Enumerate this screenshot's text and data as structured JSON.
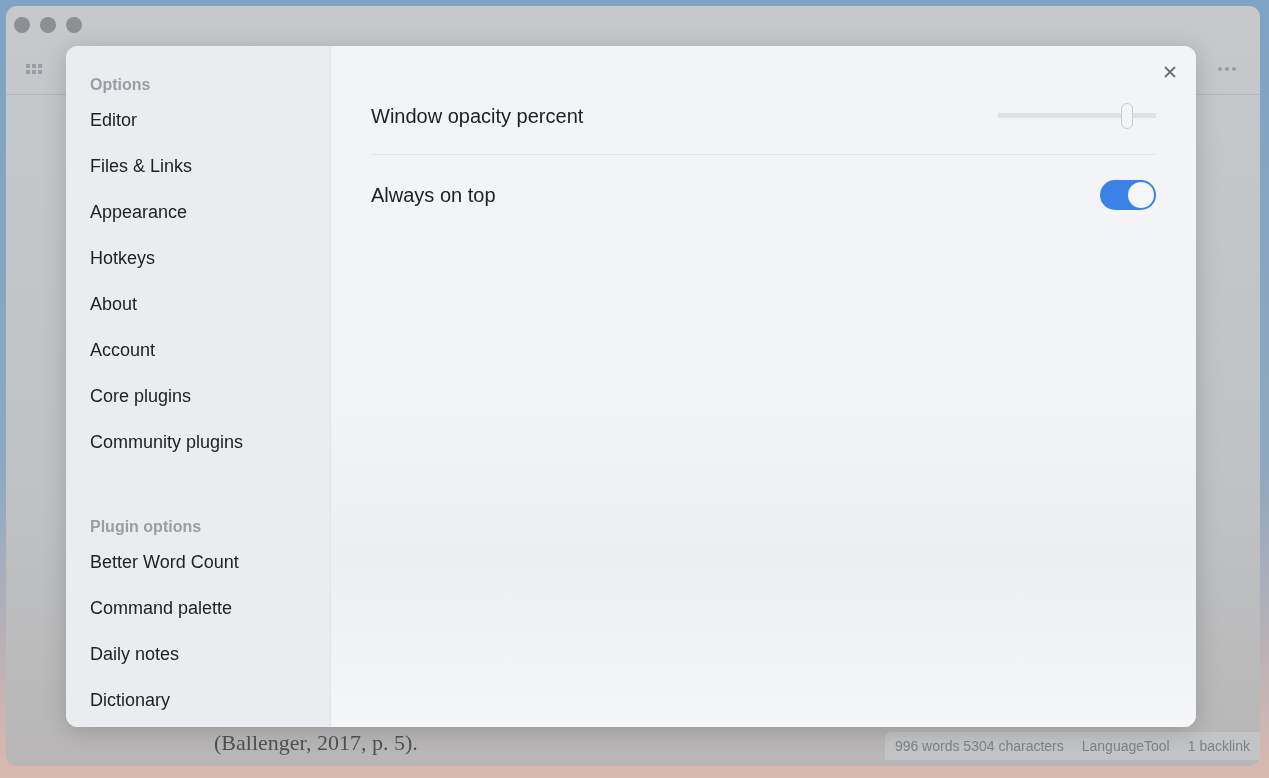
{
  "editor": {
    "text": "(Ballenger, 2017, p. 5)."
  },
  "status_bar": [
    "996 words 5304 characters",
    "LanguageTool",
    "1 backlink"
  ],
  "settings": {
    "sidebar": [
      {
        "heading": "Options",
        "items": [
          "Editor",
          "Files & Links",
          "Appearance",
          "Hotkeys",
          "About",
          "Account",
          "Core plugins",
          "Community plugins"
        ]
      },
      {
        "heading": "Plugin options",
        "items": [
          "Better Word Count",
          "Command palette",
          "Daily notes",
          "Dictionary"
        ]
      }
    ],
    "rows": [
      {
        "kind": "slider",
        "label": "Window opacity percent",
        "level": 0.82
      },
      {
        "kind": "toggle",
        "label": "Always on top",
        "on": true
      }
    ]
  }
}
